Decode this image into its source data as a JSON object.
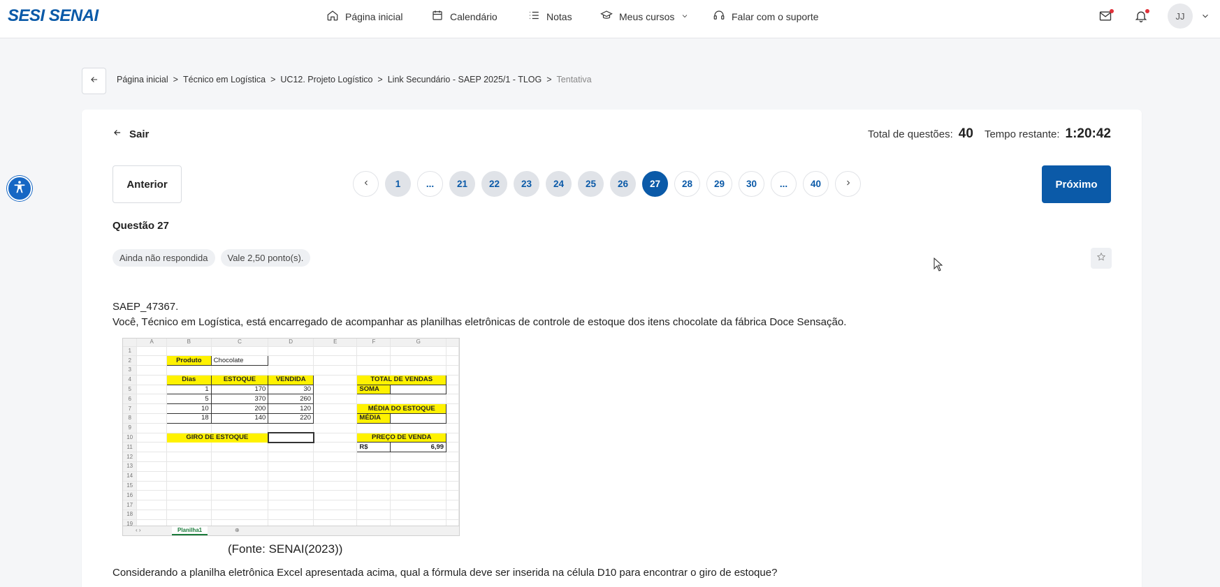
{
  "nav": {
    "logo": "SESI SENAI",
    "items": [
      {
        "label": "Página inicial",
        "icon": "home-icon"
      },
      {
        "label": "Calendário",
        "icon": "calendar-icon"
      },
      {
        "label": "Notas",
        "icon": "list-icon"
      },
      {
        "label": "Meus cursos",
        "icon": "graduation-cap-icon"
      },
      {
        "label": "Falar com o suporte",
        "icon": "headset-icon"
      }
    ],
    "avatar": "JJ"
  },
  "breadcrumb": [
    "Página inicial",
    "Técnico em Logística",
    "UC12. Projeto Logístico",
    "Link Secundário - SAEP 2025/1 - TLOG",
    "Tentativa"
  ],
  "header": {
    "exit_label": "Sair",
    "total_label": "Total de questões:",
    "total_value": "40",
    "time_label": "Tempo restante:",
    "time_value": "1:20:42"
  },
  "buttons": {
    "prev": "Anterior",
    "next": "Próximo"
  },
  "pager": [
    "1",
    "...",
    "21",
    "22",
    "23",
    "24",
    "25",
    "26",
    "27",
    "28",
    "29",
    "30",
    "...",
    "40"
  ],
  "pager_current": "27",
  "question": {
    "title": "Questão 27",
    "status": "Ainda não respondida",
    "points": "Vale 2,50 ponto(s).",
    "code": "SAEP_47367.",
    "text": "Você, Técnico em Logística, está encarregado de acompanhar as planilhas eletrônicas de controle de estoque dos itens chocolate da fábrica Doce Sensação.",
    "source": "(Fonte: SENAI(2023))",
    "prompt": "Considerando a planilha eletrônica Excel apresentada acima, qual a fórmula deve ser inserida na célula D10 para encontrar o giro de estoque?"
  },
  "spreadsheet": {
    "columns": [
      "A",
      "B",
      "C",
      "D",
      "E",
      "F",
      "G"
    ],
    "produto_label": "Produto",
    "produto_value": "Chocolate",
    "headers": [
      "Dias",
      "ESTOQUE",
      "VENDIDA"
    ],
    "rows": [
      [
        "1",
        "170",
        "30"
      ],
      [
        "5",
        "370",
        "260"
      ],
      [
        "10",
        "200",
        "120"
      ],
      [
        "18",
        "140",
        "220"
      ]
    ],
    "total_vendas": "TOTAL DE VENDAS",
    "soma": "SOMA",
    "media_estoque": "MÉDIA DO ESTOQUE",
    "media": "MÉDIA",
    "giro": "GIRO DE ESTOQUE",
    "preco_venda": "PREÇO DE VENDA",
    "moeda": "R$",
    "preco": "6,99",
    "sheet_tab": "Planilha1"
  },
  "colors": {
    "brand": "#0b5aa8",
    "highlight": "#fff200"
  }
}
